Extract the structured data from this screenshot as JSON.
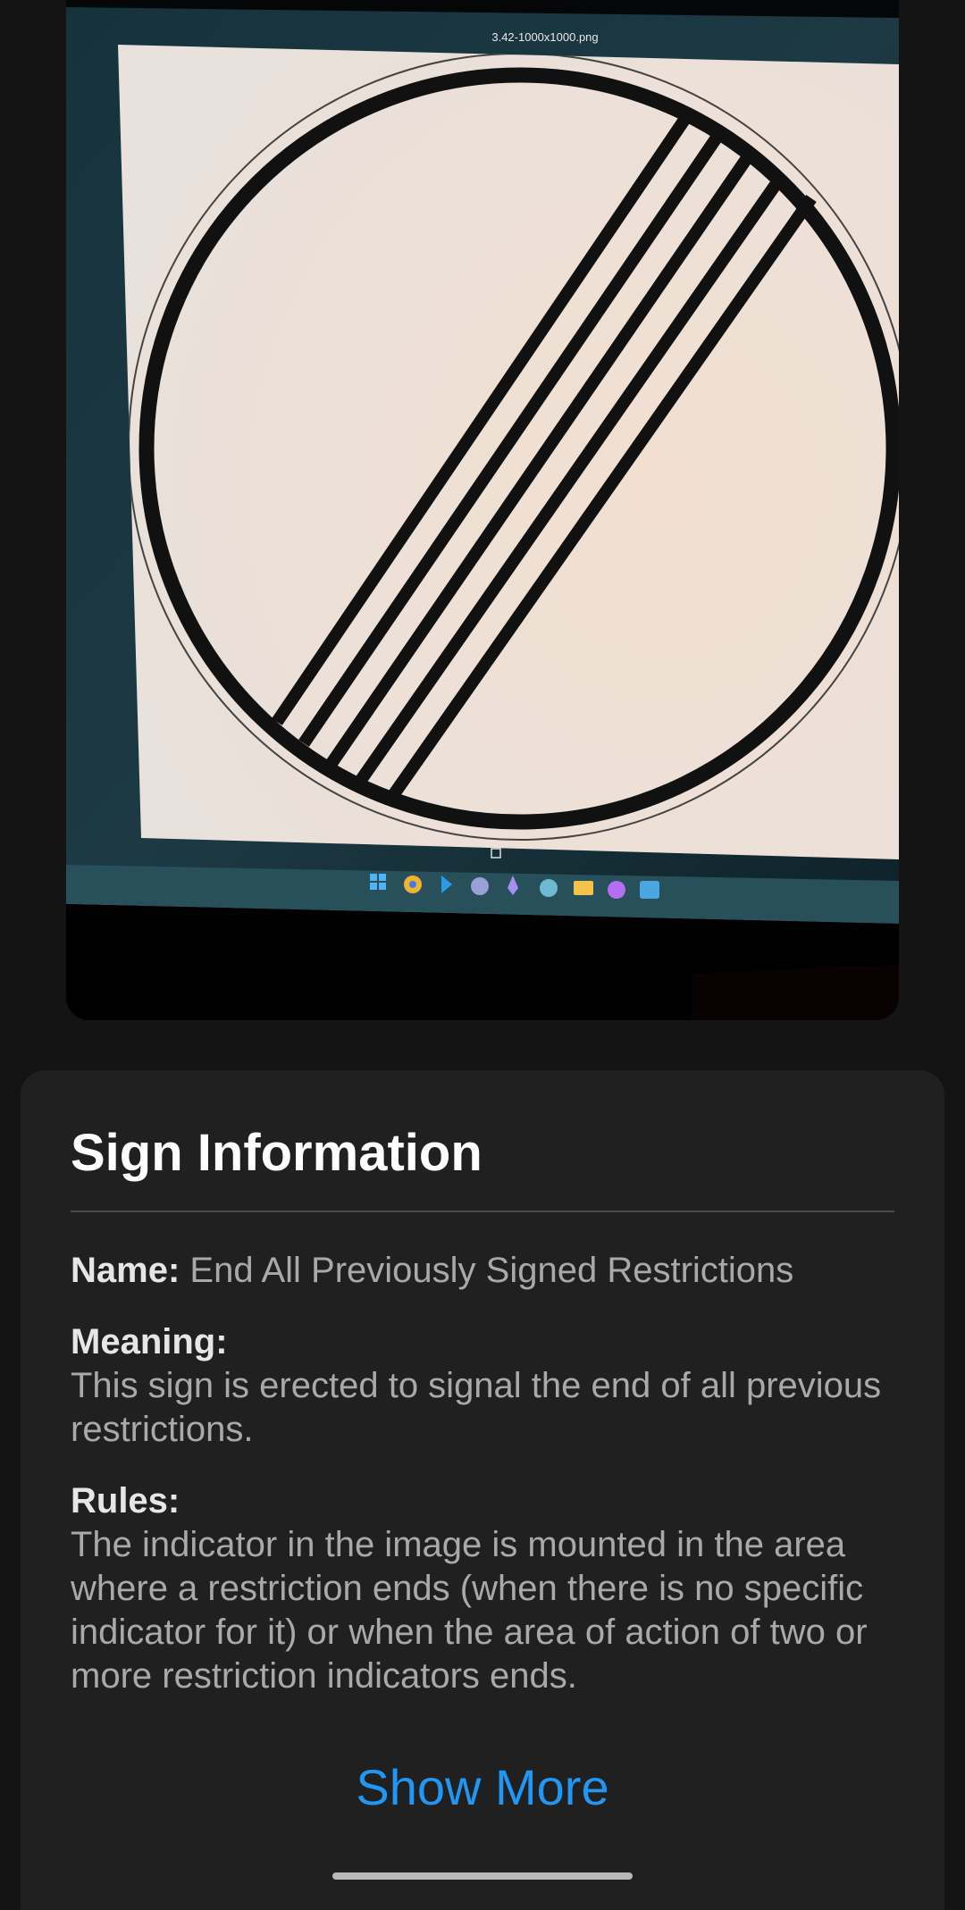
{
  "photo": {
    "screen_filename": "3.42-1000x1000.png",
    "colors": {
      "sign_background": "#efe2d6",
      "sign_ink": "#111111",
      "monitor_bezel": "#1d3a44",
      "taskbar": "#27505a"
    },
    "taskbar_icons": [
      "windows-start-icon",
      "chrome-icon",
      "vscode-icon",
      "chat-icon",
      "pen-icon",
      "app-icon",
      "folder-icon",
      "messenger-icon",
      "photos-icon"
    ]
  },
  "sign_info": {
    "title": "Sign Information",
    "name_label": "Name:",
    "name_value": "End All Previously Signed Restrictions",
    "meaning_label": "Meaning:",
    "meaning_text": "This sign is erected to signal the end of all previous restrictions.",
    "rules_label": "Rules:",
    "rules_text": "The indicator in the image is mounted in the area where a restriction ends (when there is no specific indicator for it) or when the area of action of two or more restriction indicators ends.",
    "show_more_label": "Show More",
    "accent_color": "#2196f3"
  }
}
